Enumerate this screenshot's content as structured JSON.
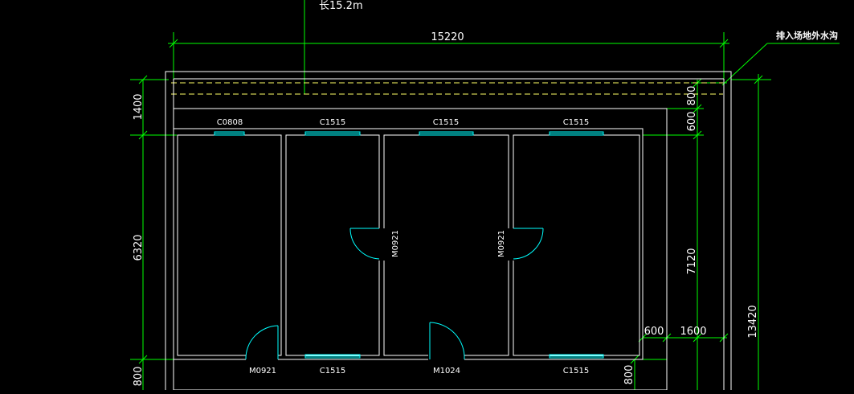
{
  "colors": {
    "background": "#000000",
    "dimension_line": "#00ff00",
    "wall": "#ffffff",
    "window_door": "#00ffff",
    "dashed_line": "#ffff66"
  },
  "annotations": {
    "length_note": "长15.2m",
    "drain_note": "排入场地外水沟"
  },
  "dimensions": {
    "top_width": "15220",
    "left_top": "1400",
    "left_mid": "6320",
    "left_bottom": "800",
    "right_800": "800",
    "right_600": "600",
    "right_7120": "7120",
    "right_bottom_800": "800",
    "right_total": "13420",
    "corner_600": "600",
    "corner_1600": "1600"
  },
  "windows": {
    "top_1": "C0808",
    "top_2": "C1515",
    "top_3": "C1515",
    "top_4": "C1515",
    "bottom_1": "C1515",
    "bottom_2": "C1515"
  },
  "doors": {
    "left_room": "M0921",
    "center": "M1024",
    "mid_left": "M0921",
    "mid_right": "M0921"
  }
}
